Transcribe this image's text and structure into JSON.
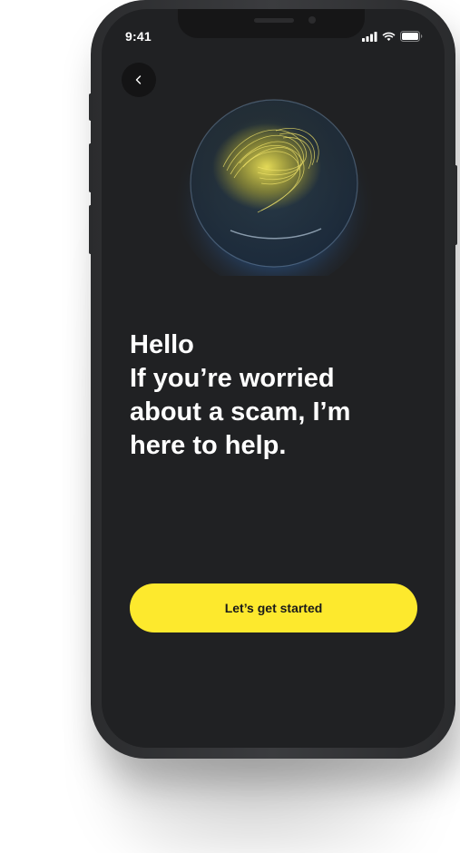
{
  "status_bar": {
    "time": "9:41"
  },
  "nav": {
    "back_icon": "chevron-left-icon"
  },
  "hero": {
    "illustration_icon": "glowing-orb-icon"
  },
  "message": {
    "line1": "Hello",
    "line2": "If you’re worried",
    "line3": "about a scam, I’m",
    "line4": "here to help."
  },
  "cta": {
    "label": "Let’s get started"
  },
  "colors": {
    "screen_background": "#202123",
    "accent": "#fde92d",
    "text_primary": "#ffffff"
  }
}
